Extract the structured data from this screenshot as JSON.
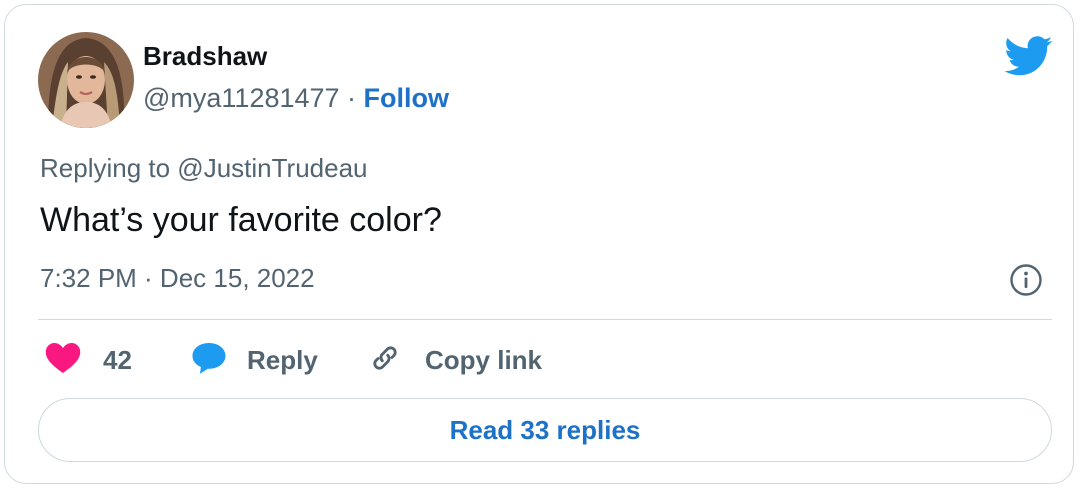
{
  "tweet": {
    "author_name": "Bradshaw",
    "handle": "@mya11281477",
    "separator": " · ",
    "follow_label": "Follow",
    "replying_to": "Replying to @JustinTrudeau",
    "text": "What’s your favorite color?",
    "timestamp": "7:32 PM · Dec 15, 2022"
  },
  "actions": {
    "like_count": "42",
    "reply_label": "Reply",
    "copy_link_label": "Copy link",
    "read_replies_label": "Read 33 replies"
  },
  "icons": {
    "brand": "twitter-bird-icon",
    "info": "info-icon",
    "like": "heart-icon",
    "reply": "speech-bubble-icon",
    "copy_link": "link-icon"
  },
  "colors": {
    "link_blue": "#1d72c7",
    "twitter_blue": "#1d9bf0",
    "heart_pink": "#f91880",
    "muted_text": "#536471",
    "border": "#cfd9de"
  }
}
